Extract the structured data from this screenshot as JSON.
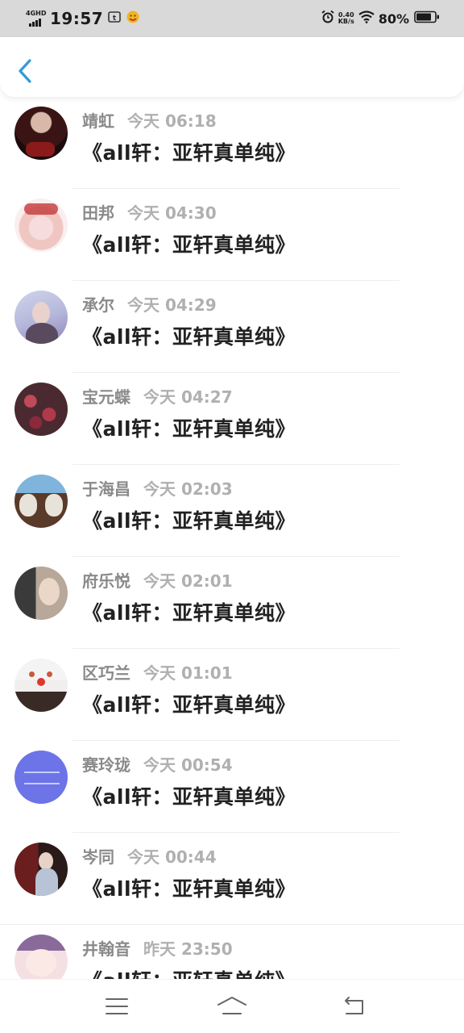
{
  "status_bar": {
    "network": "4GHD",
    "time": "19:57",
    "speed_value": "0.40",
    "speed_unit": "KB/s",
    "battery": "80%"
  },
  "header": {
    "back_icon": "chevron-left-icon",
    "accent_color": "#2f9bd9"
  },
  "list": {
    "items": [
      {
        "name": "靖虹",
        "time": "今天 06:18",
        "title": "《all轩：亚轩真单纯》"
      },
      {
        "name": "田邦",
        "time": "今天 04:30",
        "title": "《all轩：亚轩真单纯》"
      },
      {
        "name": "承尔",
        "time": "今天 04:29",
        "title": "《all轩：亚轩真单纯》"
      },
      {
        "name": "宝元蝶",
        "time": "今天 04:27",
        "title": "《all轩：亚轩真单纯》"
      },
      {
        "name": "于海昌",
        "time": "今天 02:03",
        "title": "《all轩：亚轩真单纯》"
      },
      {
        "name": "府乐悦",
        "time": "今天 02:01",
        "title": "《all轩：亚轩真单纯》"
      },
      {
        "name": "区巧兰",
        "time": "今天 01:01",
        "title": "《all轩：亚轩真单纯》"
      },
      {
        "name": "赛玲珑",
        "time": "今天 00:54",
        "title": "《all轩：亚轩真单纯》"
      },
      {
        "name": "岑同",
        "time": "今天 00:44",
        "title": "《all轩：亚轩真单纯》"
      },
      {
        "name": "井翰音",
        "time": "昨天 23:50",
        "title": "《all轩：亚轩真单纯》"
      }
    ]
  },
  "nav_bar": {
    "menu_icon": "menu-icon",
    "home_icon": "home-icon",
    "back_icon": "back-icon"
  }
}
